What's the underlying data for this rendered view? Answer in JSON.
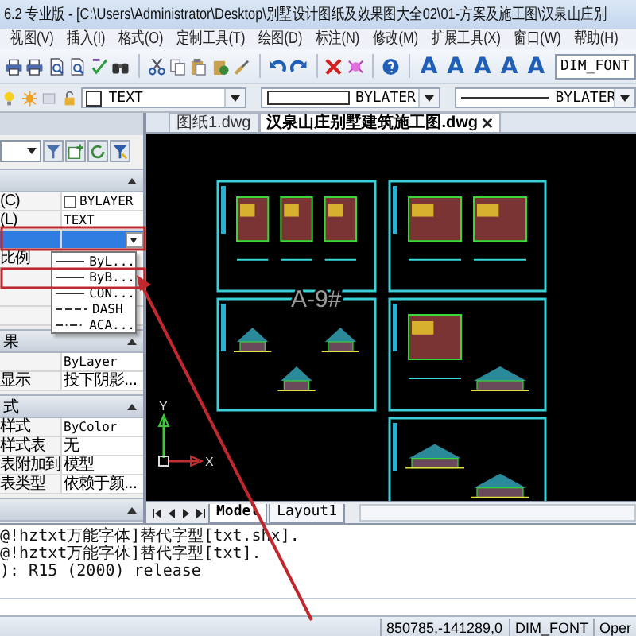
{
  "window": {
    "title": "6.2 专业版 - [C:\\Users\\Administrator\\Desktop\\别墅设计图纸及效果图大全02\\01-方案及施工图\\汉泉山庄别"
  },
  "menu": [
    "视图(V)",
    "插入(I)",
    "格式(O)",
    "定制工具(T)",
    "绘图(D)",
    "标注(N)",
    "修改(M)",
    "扩展工具(X)",
    "窗口(W)",
    "帮助(H)"
  ],
  "toolbar": {
    "text_buttons": [
      "A",
      "A",
      "A",
      "A",
      "A"
    ],
    "font_field": "DIM_FONT"
  },
  "layer_bar": {
    "layer": "TEXT",
    "color_setting": "BYLATER",
    "linetype": "BYLATER"
  },
  "properties": {
    "sections": [
      {
        "expanded": true,
        "rows": [
          {
            "label": "(C)",
            "value": "BYLAYER",
            "kind": "swatch",
            "selected": false
          },
          {
            "label": "(L)",
            "value": "TEXT",
            "kind": "text",
            "selected": false
          },
          {
            "kind": "combo",
            "selected": true
          },
          {
            "label": "比例",
            "kind": "text",
            "selected": false
          },
          {
            "kind": "text",
            "selected": false
          },
          {
            "kind": "text",
            "selected": false
          },
          {
            "kind": "text",
            "selected": false
          }
        ]
      },
      {
        "title": "果",
        "expanded": true,
        "rows": [
          {
            "value": "ByLayer",
            "kind": "text",
            "selected": false
          },
          {
            "label": "显示",
            "value": "投下阴影...",
            "kind": "text",
            "selected": false
          }
        ]
      },
      {
        "title": "式",
        "expanded": true,
        "rows": [
          {
            "label": "样式",
            "value": "ByColor",
            "kind": "text",
            "selected": false
          },
          {
            "label": "样式表",
            "value": "无",
            "kind": "text",
            "selected": false
          },
          {
            "label": "表附加到",
            "value": "模型",
            "kind": "text",
            "selected": false
          },
          {
            "label": "表类型",
            "value": "依赖于颜...",
            "kind": "text",
            "selected": false
          }
        ]
      },
      {
        "expanded": true
      }
    ],
    "linetype_list": [
      {
        "label": "ByL...",
        "kind": "solid"
      },
      {
        "label": "ByB...",
        "kind": "solid"
      },
      {
        "label": "CON...",
        "kind": "solid"
      },
      {
        "label": "DASH",
        "kind": "dash"
      },
      {
        "label": "ACA...",
        "kind": "dashdot"
      }
    ]
  },
  "document_tabs": [
    {
      "label": "图纸1.dwg",
      "selected": false
    },
    {
      "label": "汉泉山庄别墅建筑施工图.dwg",
      "selected": true
    }
  ],
  "canvas": {
    "sheet_label": "A-9#",
    "axis_labels": [
      "Y",
      "X"
    ]
  },
  "layout_tabs": [
    {
      "label": "Model",
      "selected": true
    },
    {
      "label": "Layout1",
      "selected": false
    }
  ],
  "command_history": [
    "@!hztxt万能字体]替代字型[txt.shx].",
    "@!hztxt万能字体]替代字型[txt].",
    "): R15 (2000) release"
  ],
  "status_bar": {
    "coordinates": "850785,-141289,0",
    "fields": [
      "DIM_FONT",
      "Oper"
    ]
  }
}
